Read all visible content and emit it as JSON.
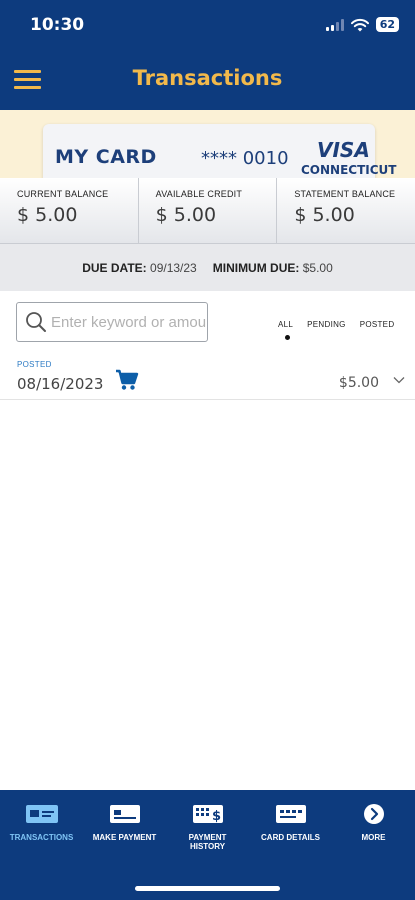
{
  "status_bar": {
    "time": "10:30",
    "battery": "62"
  },
  "header": {
    "title": "Transactions",
    "menu_icon": "hamburger-icon"
  },
  "card": {
    "name": "MY CARD",
    "number_masked": "**** 0010",
    "network": "VISA",
    "issuer_partial": "CONNECTICUT"
  },
  "balances": [
    {
      "label": "CURRENT BALANCE",
      "value": "$ 5.00"
    },
    {
      "label": "AVAILABLE CREDIT",
      "value": "$ 5.00"
    },
    {
      "label": "STATEMENT BALANCE",
      "value": "$ 5.00"
    }
  ],
  "due": {
    "due_label": "DUE DATE:",
    "due_value": "09/13/23",
    "min_label": "MINIMUM DUE:",
    "min_value": "$5.00"
  },
  "search": {
    "placeholder": "Enter keyword or amount"
  },
  "filters": {
    "all": "ALL",
    "pending": "PENDING",
    "posted": "POSTED",
    "selected": "ALL"
  },
  "transactions": [
    {
      "status": "POSTED",
      "date": "08/16/2023",
      "icon": "shopping-cart-icon",
      "amount": "$5.00"
    }
  ],
  "bottom_nav": {
    "items": [
      {
        "label": "TRANSACTIONS",
        "icon": "card-transactions-icon",
        "active": true
      },
      {
        "label": "MAKE PAYMENT",
        "icon": "card-payment-icon",
        "active": false
      },
      {
        "label": "PAYMENT HISTORY",
        "icon": "payment-history-icon",
        "active": false
      },
      {
        "label": "CARD DETAILS",
        "icon": "card-details-icon",
        "active": false
      },
      {
        "label": "MORE",
        "icon": "chevron-right-circle-icon",
        "active": false
      }
    ]
  },
  "colors": {
    "primary": "#0d3b7e",
    "accent": "#f2b94b",
    "active_nav": "#7fc4f5",
    "link_blue": "#2d7bc4"
  }
}
